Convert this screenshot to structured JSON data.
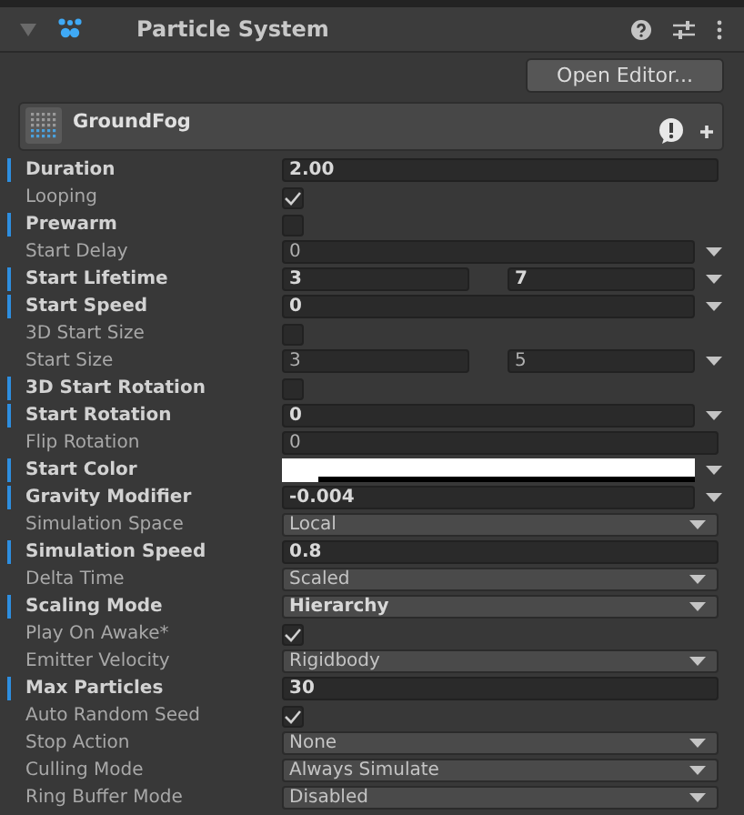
{
  "component": {
    "title": "Particle System",
    "expanded": true,
    "open_editor_button": "Open Editor..."
  },
  "system": {
    "name": "GroundFog"
  },
  "properties": [
    {
      "label": "Duration",
      "modified": true,
      "kind": "number",
      "value": "2.00"
    },
    {
      "label": "Looping",
      "modified": false,
      "kind": "checkbox",
      "checked": true
    },
    {
      "label": "Prewarm",
      "modified": true,
      "kind": "checkbox",
      "checked": false
    },
    {
      "label": "Start Delay",
      "modified": false,
      "kind": "curve",
      "value": "0"
    },
    {
      "label": "Start Lifetime",
      "modified": true,
      "kind": "range",
      "value": "3",
      "value_max": "7"
    },
    {
      "label": "Start Speed",
      "modified": true,
      "kind": "curve",
      "value": "0"
    },
    {
      "label": "3D Start Size",
      "modified": false,
      "kind": "checkbox",
      "checked": false
    },
    {
      "label": "Start Size",
      "modified": false,
      "kind": "range",
      "value": "3",
      "value_max": "5"
    },
    {
      "label": "3D Start Rotation",
      "modified": true,
      "kind": "checkbox",
      "checked": false
    },
    {
      "label": "Start Rotation",
      "modified": true,
      "kind": "curve",
      "value": "0"
    },
    {
      "label": "Flip Rotation",
      "modified": false,
      "kind": "number",
      "value": "0"
    },
    {
      "label": "Start Color",
      "modified": true,
      "kind": "color",
      "color": "#ffffff"
    },
    {
      "label": "Gravity Modifier",
      "modified": true,
      "kind": "curve",
      "value": "-0.004"
    },
    {
      "label": "Simulation Space",
      "modified": false,
      "kind": "dropdown",
      "value": "Local"
    },
    {
      "label": "Simulation Speed",
      "modified": true,
      "kind": "number",
      "value": "0.8"
    },
    {
      "label": "Delta Time",
      "modified": false,
      "kind": "dropdown",
      "value": "Scaled"
    },
    {
      "label": "Scaling Mode",
      "modified": true,
      "kind": "dropdown",
      "value": "Hierarchy"
    },
    {
      "label": "Play On Awake*",
      "modified": false,
      "kind": "checkbox",
      "checked": true
    },
    {
      "label": "Emitter Velocity",
      "modified": false,
      "kind": "dropdown",
      "value": "Rigidbody"
    },
    {
      "label": "Max Particles",
      "modified": true,
      "kind": "number",
      "value": "30"
    },
    {
      "label": "Auto Random Seed",
      "modified": false,
      "kind": "checkbox",
      "checked": true
    },
    {
      "label": "Stop Action",
      "modified": false,
      "kind": "dropdown",
      "value": "None"
    },
    {
      "label": "Culling Mode",
      "modified": false,
      "kind": "dropdown",
      "value": "Always Simulate"
    },
    {
      "label": "Ring Buffer Mode",
      "modified": false,
      "kind": "dropdown",
      "value": "Disabled"
    }
  ]
}
